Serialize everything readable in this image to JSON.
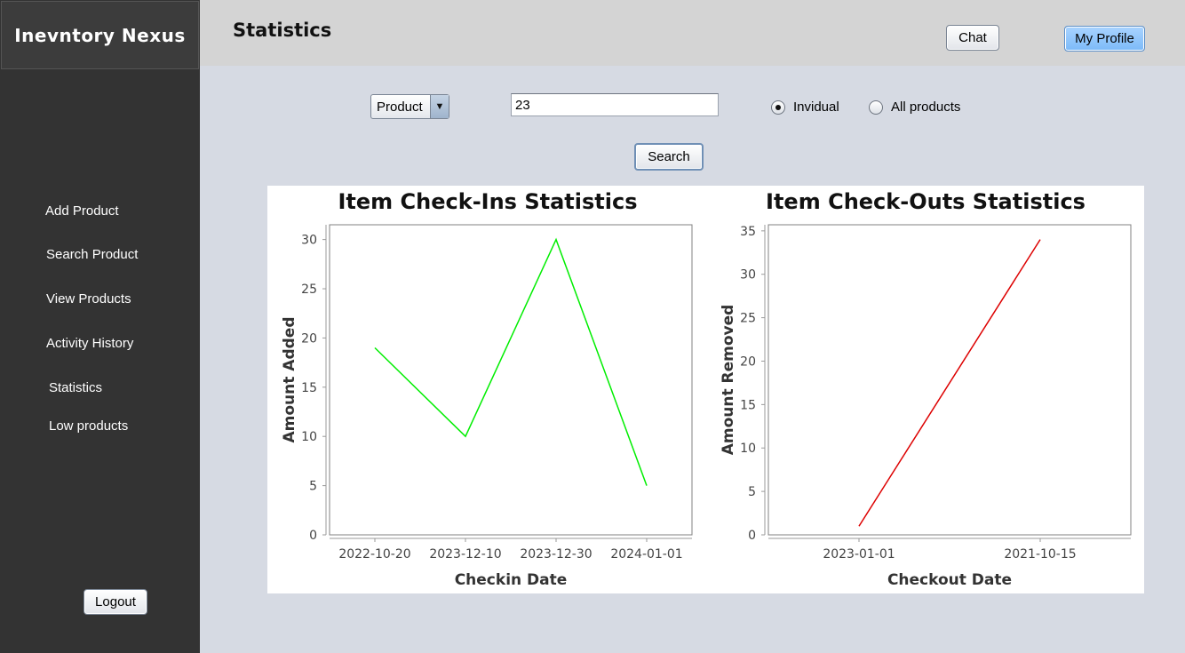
{
  "sidebar": {
    "brand": "Inevntory Nexus",
    "items": [
      {
        "label": "Add Product"
      },
      {
        "label": "Search Product"
      },
      {
        "label": "View Products"
      },
      {
        "label": "Activity History"
      },
      {
        "label": "Statistics"
      },
      {
        "label": "Low products"
      }
    ],
    "logout_label": "Logout"
  },
  "header": {
    "title": "Statistics",
    "chat_label": "Chat",
    "profile_label": "My Profile"
  },
  "filters": {
    "type_selected": "Product",
    "search_value": "23",
    "radio_individual": "Invidual",
    "radio_all": "All products",
    "selected_radio": "individual",
    "search_label": "Search"
  },
  "chart_data": [
    {
      "type": "line",
      "title": "Item Check-Ins Statistics",
      "xlabel": "Checkin Date",
      "ylabel": "Amount Added",
      "categories": [
        "2022-10-20",
        "2023-12-10",
        "2023-12-30",
        "2024-01-01"
      ],
      "series": [
        {
          "values": [
            19,
            10,
            30,
            5
          ],
          "color": "#00ee00"
        }
      ],
      "ylim": [
        0,
        31.5
      ],
      "yticks": [
        0,
        5,
        10,
        15,
        20,
        25,
        30
      ],
      "grid": false,
      "legend": "none"
    },
    {
      "type": "line",
      "title": "Item Check-Outs Statistics",
      "xlabel": "Checkout Date",
      "ylabel": "Amount Removed",
      "categories": [
        "2023-01-01",
        "2021-10-15"
      ],
      "series": [
        {
          "values": [
            1,
            34
          ],
          "color": "#dd0000"
        }
      ],
      "ylim": [
        0,
        35.7
      ],
      "yticks": [
        0,
        5,
        10,
        15,
        20,
        25,
        30,
        35
      ],
      "grid": false,
      "legend": "none"
    }
  ]
}
